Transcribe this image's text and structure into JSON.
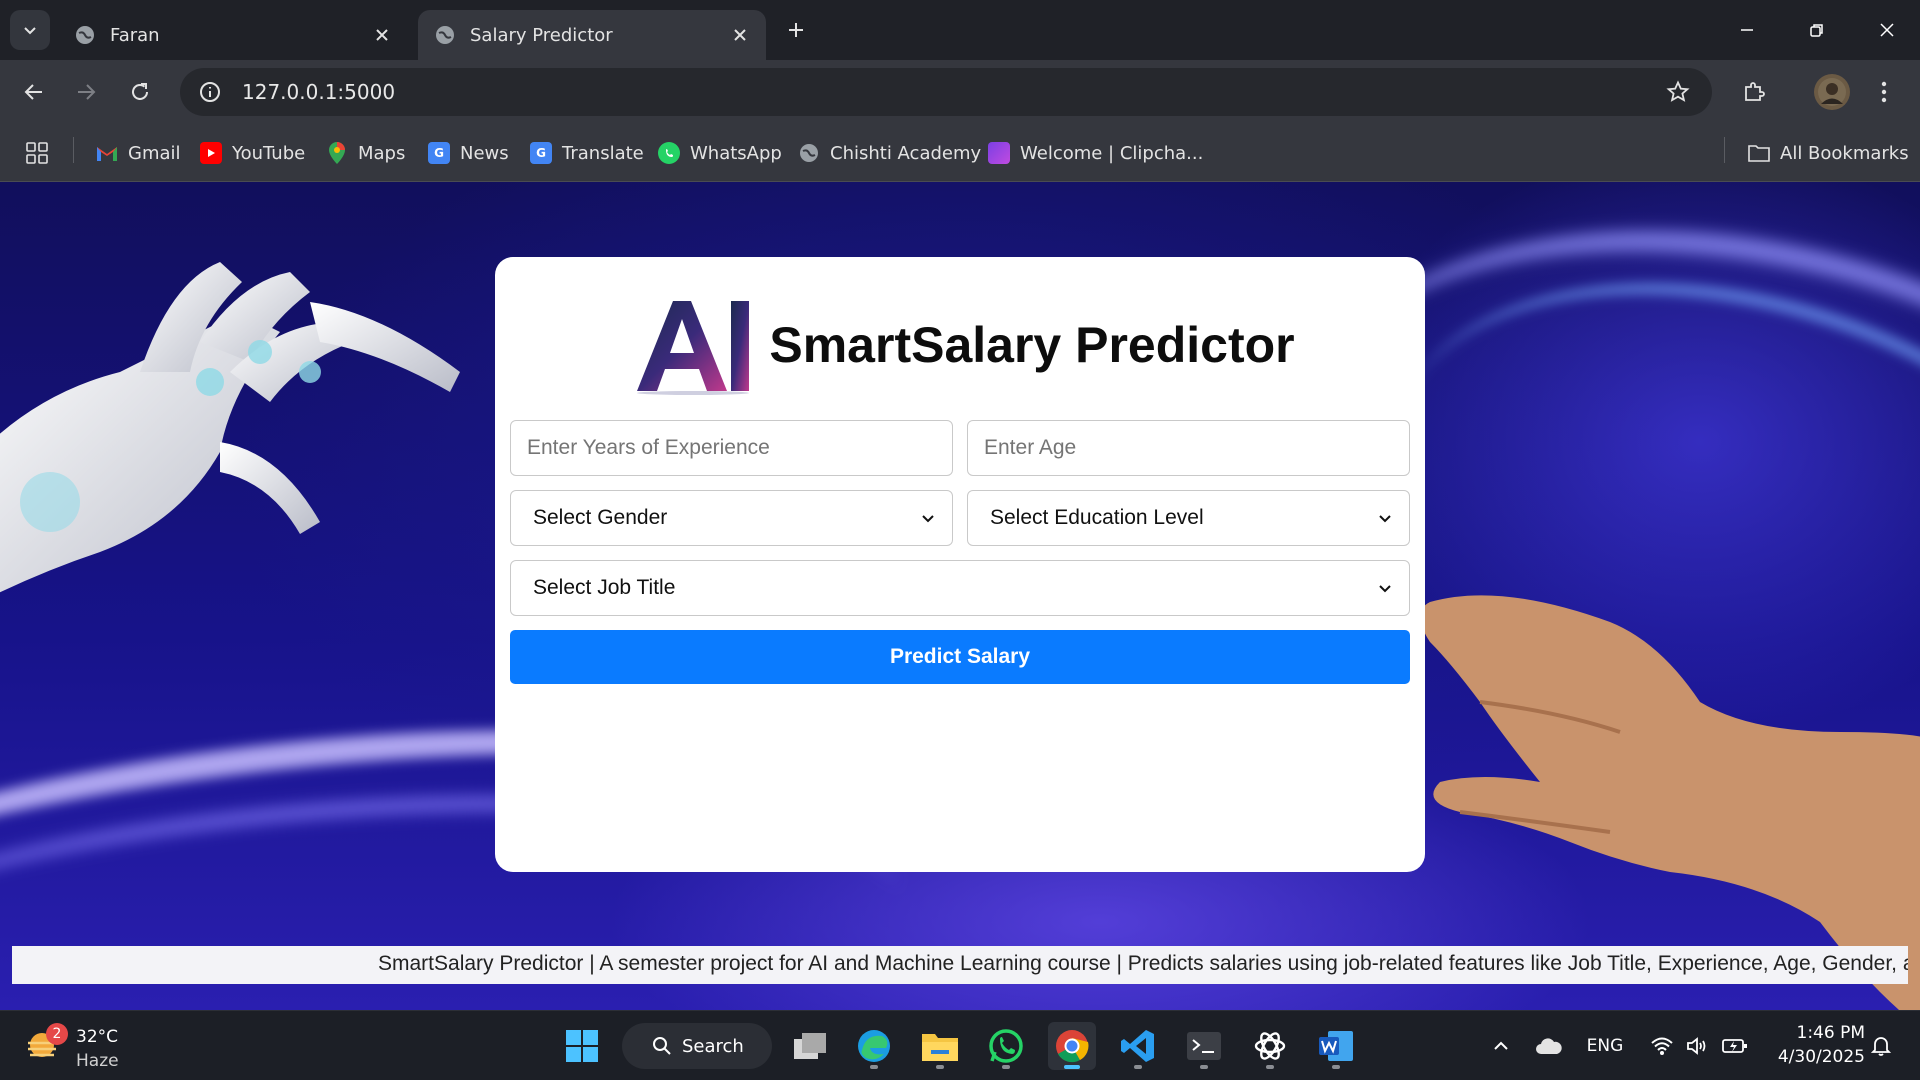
{
  "browser": {
    "tabs": [
      {
        "title": "Faran",
        "active": false
      },
      {
        "title": "Salary Predictor",
        "active": true
      }
    ],
    "url": "127.0.0.1:5000",
    "bookmarks": [
      {
        "label": "Gmail",
        "icon": "gmail-icon"
      },
      {
        "label": "YouTube",
        "icon": "youtube-icon"
      },
      {
        "label": "Maps",
        "icon": "maps-icon"
      },
      {
        "label": "News",
        "icon": "news-icon"
      },
      {
        "label": "Translate",
        "icon": "translate-icon"
      },
      {
        "label": "WhatsApp",
        "icon": "whatsapp-icon"
      },
      {
        "label": "Chishti Academy",
        "icon": "globe-icon"
      },
      {
        "label": "Welcome | Clipcha...",
        "icon": "clipchamp-icon"
      }
    ],
    "all_bookmarks_label": "All Bookmarks"
  },
  "app": {
    "logo_text": "AI",
    "title": "SmartSalary Predictor",
    "fields": {
      "experience_placeholder": "Enter Years of Experience",
      "age_placeholder": "Enter Age",
      "gender_selected": "Select Gender",
      "education_selected": "Select Education Level",
      "job_title_selected": "Select Job Title"
    },
    "predict_button": "Predict Salary",
    "marquee": "SmartSalary Predictor | A semester project for AI and Machine Learning course | Predicts salaries using job-related features like Job Title, Experience, Age, Gender, a"
  },
  "taskbar": {
    "weather": {
      "temp": "32°C",
      "condition": "Haze",
      "badge": "2"
    },
    "search_label": "Search",
    "language": "ENG",
    "time": "1:46 PM",
    "date": "4/30/2025"
  },
  "colors": {
    "accent": "#0a7bff",
    "page_background": "#17138a",
    "chrome_dark": "#1f2127",
    "chrome_toolbar": "#35373e"
  }
}
